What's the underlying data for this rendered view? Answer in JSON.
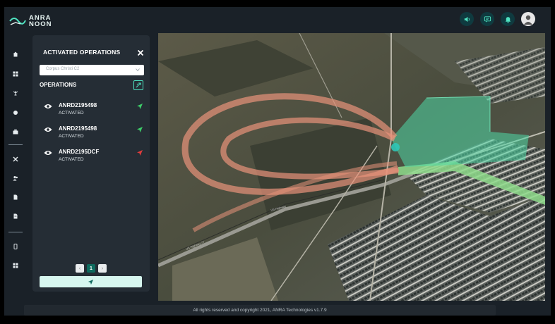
{
  "app": {
    "logo_line1": "ANRA",
    "logo_line2": "NOON"
  },
  "header": {
    "icons": [
      "speaker-icon",
      "chat-icon",
      "bell-icon",
      "user-avatar"
    ]
  },
  "sidebar": {
    "icons": [
      "home-icon",
      "grid-icon",
      "drone-icon",
      "circle-icon",
      "briefcase-icon",
      "tools-icon",
      "users-icon",
      "document-icon",
      "report-icon",
      "mobile-icon",
      "apps-icon"
    ]
  },
  "panel": {
    "title": "ACTIVATED OPERATIONS",
    "close_icon": "close-icon",
    "location_select": {
      "value": "Corpus Christi C2"
    },
    "operations_label": "OPERATIONS",
    "operations": [
      {
        "id": "ANRD2195498",
        "status": "ACTIVATED",
        "arrow_color": "#3ecf6a"
      },
      {
        "id": "ANRD2195498",
        "status": "ACTIVATED",
        "arrow_color": "#3ecf6a"
      },
      {
        "id": "ANRD2195DCF",
        "status": "ACTIVATED",
        "arrow_color": "#e23c3c"
      }
    ],
    "pagination": {
      "prev": "‹",
      "current": "1",
      "next": "›"
    }
  },
  "map": {
    "road_labels": [
      "US Highway",
      "US Highway 77"
    ]
  },
  "footer": {
    "copyright": "All rights reserved and copyright 2021, ANRA Technologies v1.7.9"
  },
  "colors": {
    "accent": "#4fe3c1",
    "panel_bg": "#252d35",
    "app_bg": "#1a2128",
    "flight_path": "#e8937a",
    "volume": "#5fd6a0"
  }
}
